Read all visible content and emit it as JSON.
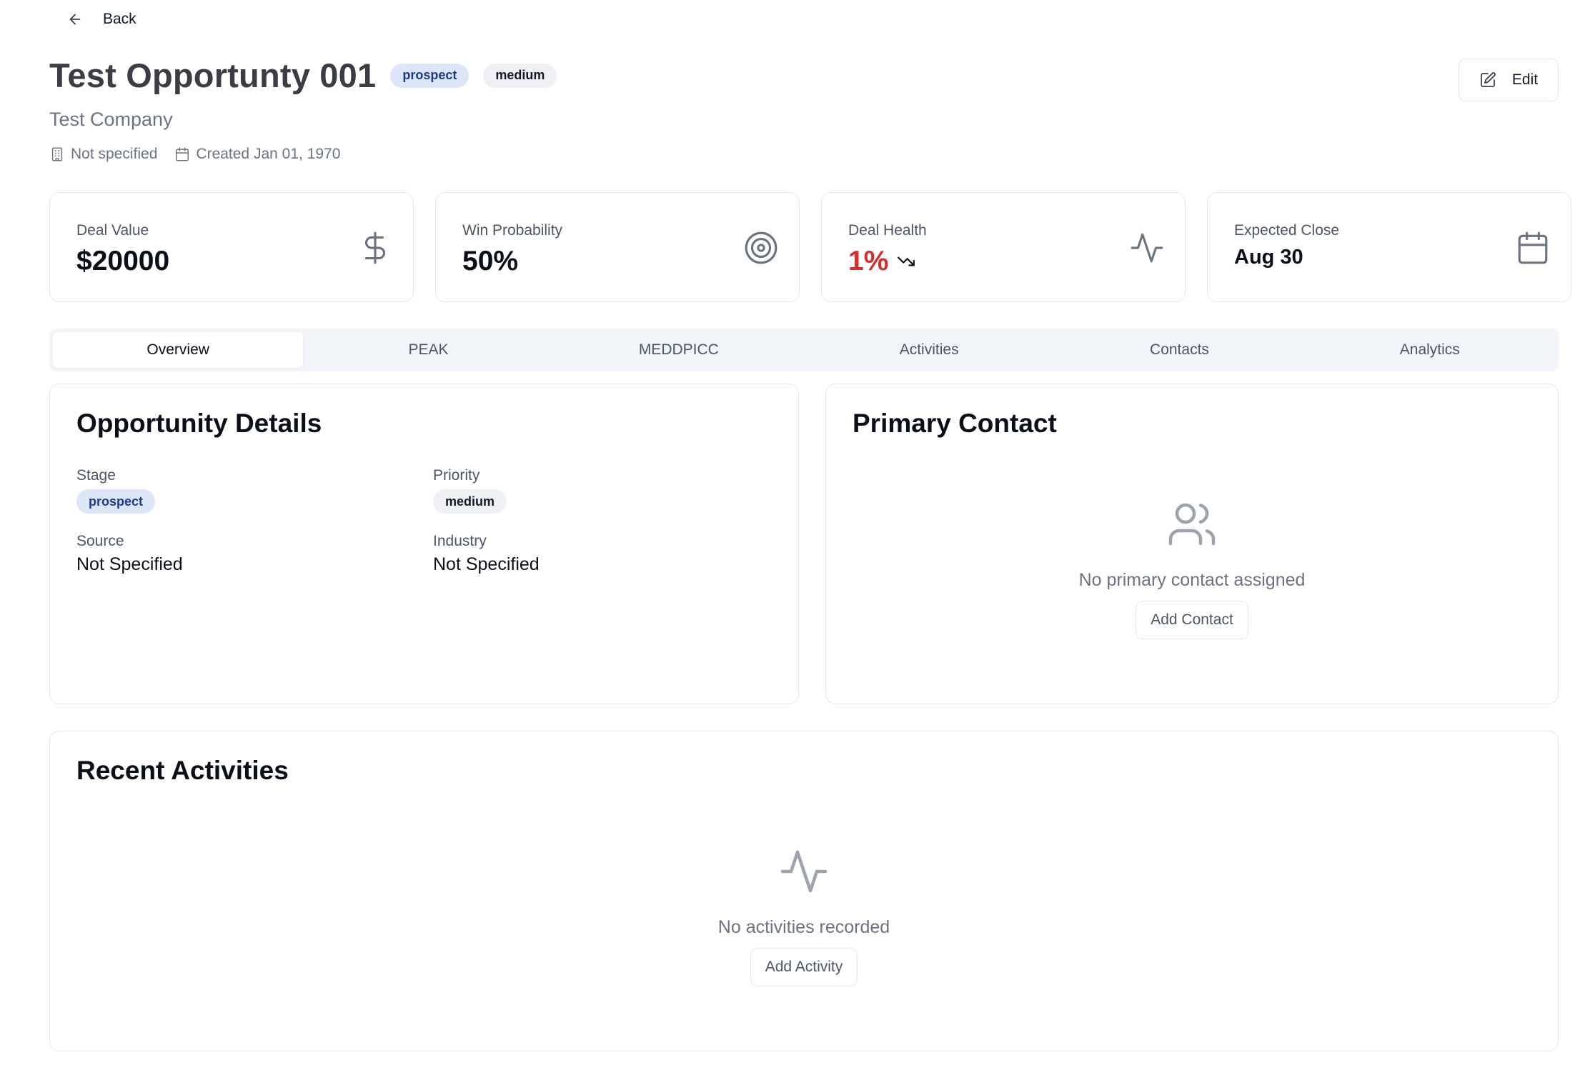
{
  "nav": {
    "back_label": "Back"
  },
  "header": {
    "title": "Test Opportunty 001",
    "stage_badge": "prospect",
    "priority_badge": "medium",
    "company": "Test Company",
    "location": "Not specified",
    "created": "Created Jan 01, 1970",
    "edit_label": "Edit"
  },
  "stats": [
    {
      "label": "Deal Value",
      "value": "$20000",
      "icon": "dollar-icon"
    },
    {
      "label": "Win Probability",
      "value": "50%",
      "icon": "target-icon"
    },
    {
      "label": "Deal Health",
      "value": "1%",
      "icon": "activity-icon",
      "trend_icon": "trending-down-icon",
      "value_color": "#d32f2f"
    },
    {
      "label": "Expected Close",
      "value": "Aug 30",
      "icon": "calendar-icon"
    }
  ],
  "tabs": [
    {
      "label": "Overview",
      "active": true
    },
    {
      "label": "PEAK",
      "active": false
    },
    {
      "label": "MEDDPICC",
      "active": false
    },
    {
      "label": "Activities",
      "active": false
    },
    {
      "label": "Contacts",
      "active": false
    },
    {
      "label": "Analytics",
      "active": false
    }
  ],
  "details": {
    "title": "Opportunity Details",
    "stage_label": "Stage",
    "stage_value": "prospect",
    "priority_label": "Priority",
    "priority_value": "medium",
    "source_label": "Source",
    "source_value": "Not Specified",
    "industry_label": "Industry",
    "industry_value": "Not Specified"
  },
  "contact": {
    "title": "Primary Contact",
    "empty_text": "No primary contact assigned",
    "add_label": "Add Contact",
    "icon": "users-icon"
  },
  "activities": {
    "title": "Recent Activities",
    "empty_text": "No activities recorded",
    "add_label": "Add Activity",
    "icon": "activity-icon"
  },
  "colors": {
    "accent_badge_bg": "#dde6f8",
    "accent_badge_text": "#1e3a8a",
    "danger": "#d32f2f",
    "tab_bar_bg": "#f1f5f9"
  }
}
